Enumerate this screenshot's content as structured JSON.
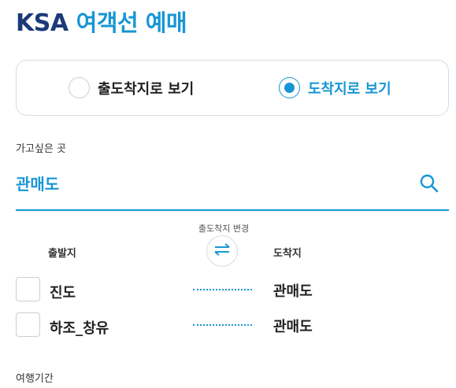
{
  "header": {
    "brand": "KSA",
    "title": "여객선 예매"
  },
  "view_toggle": {
    "options": [
      {
        "label": "출도착지로 보기",
        "checked": false
      },
      {
        "label": "도착지로 보기",
        "checked": true
      }
    ]
  },
  "destination": {
    "label": "가고싶은 곳",
    "value": "관매도"
  },
  "swap": {
    "caption": "출도착지 변경"
  },
  "columns": {
    "departure": "출발지",
    "arrival": "도착지"
  },
  "routes": [
    {
      "from": "진도",
      "to": "관매도",
      "selected": false
    },
    {
      "from": "하조_창유",
      "to": "관매도",
      "selected": false
    }
  ],
  "period": {
    "label": "여행기간"
  },
  "colors": {
    "brand_navy": "#1b3a78",
    "accent_blue": "#1796d4",
    "border_gray": "#d6dbe2"
  }
}
